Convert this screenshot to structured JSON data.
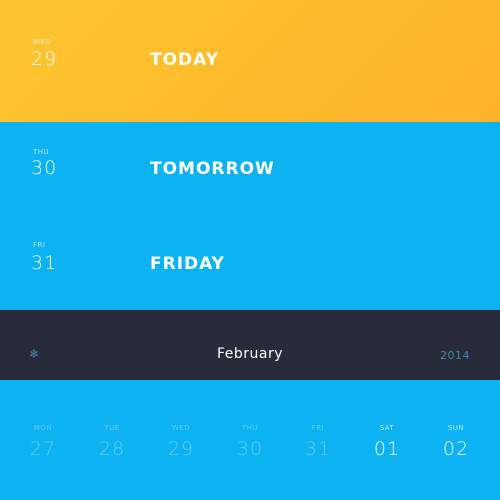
{
  "colors": {
    "today_bg": "#fdbf2d",
    "sky_blue": "#0cb2f1",
    "month_bar": "#272b3a",
    "muted_blue": "#4a86a8"
  },
  "days": [
    {
      "weekday": "WED",
      "date": "29",
      "title": "TODAY"
    },
    {
      "weekday": "THU",
      "date": "30",
      "title": "TOMORROW"
    },
    {
      "weekday": "FRI",
      "date": "31",
      "title": "FRIDAY"
    }
  ],
  "month_bar": {
    "icon": "snowflake-icon",
    "icon_glyph": "❄",
    "month": "February",
    "year": "2014"
  },
  "week": [
    {
      "label": "MON",
      "num": "27"
    },
    {
      "label": "TUE",
      "num": "28"
    },
    {
      "label": "WED",
      "num": "29"
    },
    {
      "label": "THU",
      "num": "30"
    },
    {
      "label": "FRI",
      "num": "31"
    },
    {
      "label": "SAT",
      "num": "01"
    },
    {
      "label": "SUN",
      "num": "02"
    }
  ]
}
